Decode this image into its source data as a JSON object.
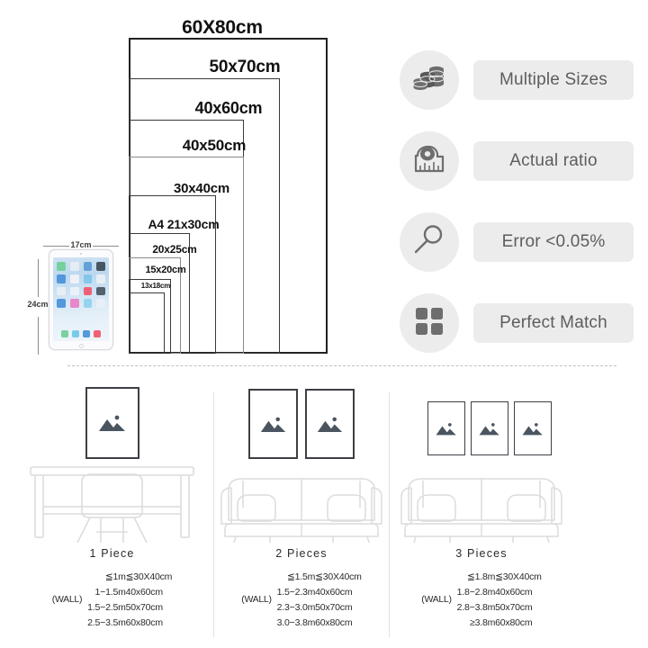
{
  "size_chart": {
    "sizes": [
      {
        "key": "60x80",
        "label": "60X80cm"
      },
      {
        "key": "50x70",
        "label": "50x70cm"
      },
      {
        "key": "40x60",
        "label": "40x60cm"
      },
      {
        "key": "40x50",
        "label": "40x50cm"
      },
      {
        "key": "30x40",
        "label": "30x40cm"
      },
      {
        "key": "a4",
        "label": "A4  21x30cm"
      },
      {
        "key": "20x25",
        "label": "20x25cm"
      },
      {
        "key": "15x20",
        "label": "15x20cm"
      },
      {
        "key": "13x18",
        "label": "13x18cm"
      }
    ]
  },
  "device": {
    "name": "ipad",
    "width_label": "17cm",
    "height_label": "24cm",
    "app_colors": [
      "#6fcf97",
      "#e8eef4",
      "#5b9bd5",
      "#3d4a57",
      "#4a90d9",
      "#f2f4f6",
      "#7fc4e8",
      "#eaf0f5",
      "#e9eff5",
      "#eef3f7",
      "#f2556a",
      "#4a5663",
      "#4a90d9",
      "#e87fc4",
      "#8fd0ee",
      "#e9eff5"
    ],
    "dock_colors": [
      "#6fcf97",
      "#6ec8e8",
      "#4a90d9",
      "#f2556a"
    ]
  },
  "features": [
    {
      "icon": "coins-icon",
      "label": "Multiple Sizes"
    },
    {
      "icon": "tape-measure-icon",
      "label": "Actual ratio"
    },
    {
      "icon": "magnifier-icon",
      "label": "Error <0.05%"
    },
    {
      "icon": "grid-squares-icon",
      "label": "Perfect Match"
    }
  ],
  "placement_guide": {
    "wall_tag": "(WALL)",
    "headers": [
      "distance",
      "recommended_size"
    ],
    "panels": [
      {
        "id": "one-piece",
        "title": "1 Piece",
        "frames": 1,
        "furniture": "desk-chair",
        "rows": [
          {
            "distance": "≦1m",
            "size": "≦30X40cm"
          },
          {
            "distance": "1−1.5m",
            "size": "40x60cm"
          },
          {
            "distance": "1.5−2.5m",
            "size": "50x70cm"
          },
          {
            "distance": "2.5−3.5m",
            "size": "60x80cm"
          }
        ]
      },
      {
        "id": "two-pieces",
        "title": "2 Pieces",
        "frames": 2,
        "furniture": "sofa",
        "rows": [
          {
            "distance": "≦1.5m",
            "size": "≦30X40cm"
          },
          {
            "distance": "1.5−2.3m",
            "size": "40x60cm"
          },
          {
            "distance": "2.3−3.0m",
            "size": "50x70cm"
          },
          {
            "distance": "3.0−3.8m",
            "size": "60x80cm"
          }
        ]
      },
      {
        "id": "three-pieces",
        "title": "3 Pieces",
        "frames": 3,
        "furniture": "sofa",
        "rows": [
          {
            "distance": "≦1.8m",
            "size": "≦30X40cm"
          },
          {
            "distance": "1.8−2.8m",
            "size": "40x60cm"
          },
          {
            "distance": "2.8−3.8m",
            "size": "50x70cm"
          },
          {
            "distance": "≥3.8m",
            "size": "60x80cm"
          }
        ]
      }
    ]
  },
  "colors": {
    "badge_bg": "#ececec",
    "pill_bg": "#ececec",
    "text": "#5d5d5d",
    "icon": "#6e6e6e",
    "frame_border": "#3c4045",
    "mountain": "#4a5560",
    "furniture_line": "#dcdcdc",
    "rect_border": "#3a3a3a"
  }
}
